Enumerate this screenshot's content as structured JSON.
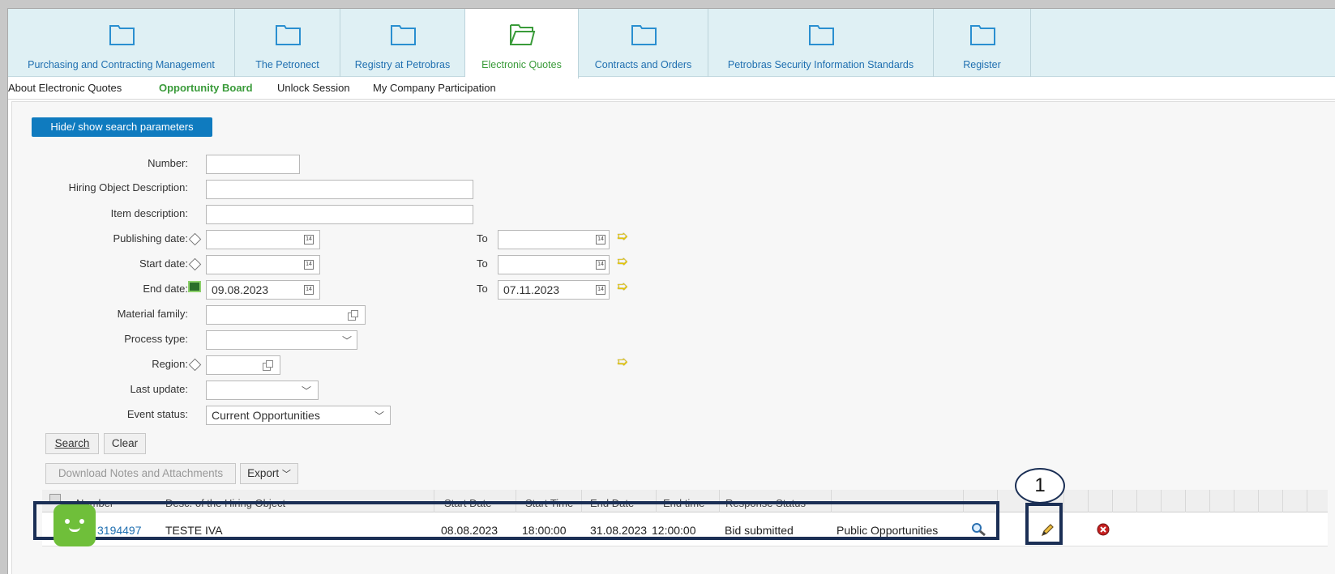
{
  "tabs": [
    {
      "label": "Purchasing and Contracting Management",
      "active": false
    },
    {
      "label": "The Petronect",
      "active": false
    },
    {
      "label": "Registry at Petrobras",
      "active": false
    },
    {
      "label": "Electronic Quotes",
      "active": true
    },
    {
      "label": "Contracts and Orders",
      "active": false
    },
    {
      "label": "Petrobras Security Information Standards",
      "active": false
    },
    {
      "label": "Register",
      "active": false
    }
  ],
  "subnav": [
    "About Electronic Quotes",
    "Opportunity Board",
    "Unlock Session",
    "My Company Participation"
  ],
  "toggle_label": "Hide/ show search parameters",
  "form": {
    "number_label": "Number:",
    "hiring_label": "Hiring Object Description:",
    "item_label": "Item description:",
    "publishing_label": "Publishing date:",
    "start_label": "Start date:",
    "end_label": "End date:",
    "end_from": "09.08.2023",
    "end_to": "07.11.2023",
    "to_label": "To",
    "cal_text": "14",
    "material_label": "Material family:",
    "process_label": "Process type:",
    "region_label": "Region:",
    "last_update_label": "Last update:",
    "event_status_label": "Event status:",
    "event_status_value": "Current Opportunities"
  },
  "buttons": {
    "search": "Search",
    "clear": "Clear",
    "download": "Download Notes and Attachments",
    "export": "Export"
  },
  "grid": {
    "columns": [
      "Number",
      "Desc. of the Hiring Object",
      "Start Date",
      "Start Time",
      "End Date",
      "End time",
      "Response Status"
    ],
    "row": {
      "number": "3194497",
      "desc": "TESTE IVA",
      "start_date": "08.08.2023",
      "start_time": "18:00:00",
      "end_date": "31.08.2023",
      "end_time": "12:00:00",
      "status": "Bid submitted",
      "type": "Public Opportunities"
    }
  },
  "callout": "1",
  "colors": {
    "accent_blue": "#0f7bbf",
    "active_green": "#3a9b3a",
    "highlight_navy": "#1b2f55"
  },
  "icons": [
    "folder-icon",
    "folder-open-icon",
    "calendar-icon",
    "diamond-icon",
    "arrow-right-icon",
    "value-help-icon",
    "chevron-down-icon",
    "magnifier-icon",
    "pencil-icon",
    "delete-icon",
    "mascot-icon"
  ]
}
